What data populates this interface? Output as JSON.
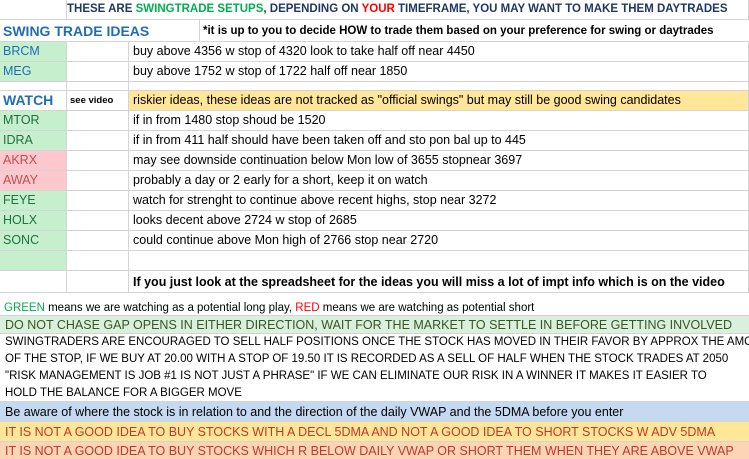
{
  "header": {
    "part1": "THESE ARE ",
    "part2": "SWINGTRADE SETUPS",
    "part3": ", DEPENDING ON ",
    "part4": "YOUR",
    "part5": " TIMEFRAME, YOU MAY WANT TO MAKE THEM DAYTRADES"
  },
  "swing_section": {
    "title": "SWING TRADE IDEAS",
    "note": "*it is up to you to decide HOW to trade them based on your preference for swing or daytrades",
    "rows": [
      {
        "ticker": "BRCM",
        "text": "buy above 4356 w stop of 4320 look to take half off near 4450"
      },
      {
        "ticker": "MEG",
        "text": "buy above 1752 w stop of 1722 half off near 1850"
      }
    ]
  },
  "watch_section": {
    "title": "WATCH",
    "see_video": "see video",
    "intro": "riskier ideas,  these ideas are not tracked as \"official swings\" but may still be good swing candidates",
    "rows": [
      {
        "ticker": "MTOR",
        "text": "if in from 1480 stop shoud be 1520"
      },
      {
        "ticker": "IDRA",
        "text": "if in from 411 half should have been taken off and sto pon bal up to 445"
      },
      {
        "ticker": "AKRX",
        "text": "may see downside continuation below Mon low of 3655 stopnear 3697"
      },
      {
        "ticker": "AWAY",
        "text": "probably a day or 2 early for a short, keep it on watch"
      },
      {
        "ticker": "FEYE",
        "text": "watch for strenght to continue above recent highs, stop near 3272"
      },
      {
        "ticker": "HOLX",
        "text": "looks decent above 2724 w stop of 2685"
      },
      {
        "ticker": "SONC",
        "text": "could continue above Mon high of 2766 stop near 2720"
      }
    ]
  },
  "video_note": "If you just look at the spreadsheet for the ideas you will miss a lot of impt info which is on the video",
  "legend": {
    "green_word": "GREEN",
    "green_text": " means we are watching as a potential long play, ",
    "red_word": "RED",
    "red_text": " means we are watching as potential short"
  },
  "notes": [
    "DO NOT CHASE GAP OPENS IN EITHER DIRECTION, WAIT FOR THE MARKET TO SETTLE IN BEFORE GETTING INVOLVED",
    "SWINGTRADERS ARE ENCOURAGED TO SELL HALF POSITIONS ONCE THE STOCK HAS MOVED IN THEIR FAVOR BY APPROX THE AMOUNT",
    "OF THE STOP, IF WE BUY AT 20.00 WITH A STOP OF 19.50 IT IS RECORDED AS A SELL OF HALF WHEN THE STOCK TRADES AT 2050",
    "\"RISK MANAGEMENT IS JOB #1 IS NOT JUST A PHRASE\" IF WE CAN ELIMINATE OUR RISK IN A WINNER IT MAKES IT EASIER TO",
    "HOLD THE BALANCE FOR A BIGGER MOVE",
    "Be aware of where the stock is in relation to and the direction of the daily VWAP and the 5DMA before you enter",
    "IT IS NOT A GOOD IDEA TO BUY STOCKS WITH A DECL 5DMA AND NOT A GOOD IDEA TO SHORT STOCKS W ADV 5DMA",
    "IT IS NOT A GOOD IDEA TO BUY STOCKS WHICH R BELOW DAILY VWAP OR SHORT THEM WHEN THEY ARE ABOVE VWAP"
  ],
  "colors": {
    "long": "#c6efce",
    "short": "#ffc7ce",
    "watch_intro": "#ffe699",
    "vwap_note": "#c5d9f1",
    "accent_title": "#1f6eb3",
    "header_green": "#00b050",
    "header_red": "#ff0000"
  }
}
